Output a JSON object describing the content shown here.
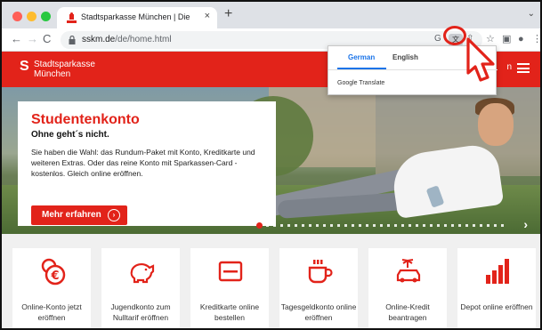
{
  "browser": {
    "tab_title": "Stadtsparkasse München | Die",
    "tab_close": "×",
    "new_tab": "+",
    "tab_menu": "⌄",
    "url_host": "sskm.de",
    "url_path": "/de/home.html",
    "back": "←",
    "forward": "→",
    "reload": "C",
    "google_icon": "G",
    "translate_icon": "文",
    "share_icon": "⇧",
    "bookmark_icon": "☆",
    "sidepanel_icon": "▣",
    "profile_icon": "●",
    "menu_icon": "⋮"
  },
  "translate_popup": {
    "lang_source": "German",
    "lang_target": "English",
    "brand": "Google Translate"
  },
  "site": {
    "logo_symbol": "S",
    "logo_line1": "Stadtsparkasse",
    "logo_line2": "München",
    "header_partial": "n",
    "hero": {
      "title": "Studentenkonto",
      "subtitle": "Ohne geht´s nicht.",
      "text": "Sie haben die Wahl: das Rundum-Paket mit Konto, Kreditkarte und weiteren Extras. Oder das reine Konto mit Sparkassen-Card - kostenlos. Gleich online eröffnen.",
      "button": "Mehr erfahren",
      "button_icon": "›",
      "next_arrow": "›"
    },
    "tiles": [
      {
        "label": "Online-Konto jetzt eröffnen",
        "icon": "euro-coin-icon"
      },
      {
        "label": "Jugendkonto zum Nulltarif eröffnen",
        "icon": "piggy-bank-icon"
      },
      {
        "label": "Kreditkarte online bestellen",
        "icon": "credit-card-icon"
      },
      {
        "label": "Tagesgeldkonto online eröffnen",
        "icon": "coffee-cup-icon"
      },
      {
        "label": "Online-Kredit beantragen",
        "icon": "car-palm-icon"
      },
      {
        "label": "Depot online eröffnen",
        "icon": "bar-chart-icon"
      }
    ],
    "brand_color": "#e2231a"
  }
}
